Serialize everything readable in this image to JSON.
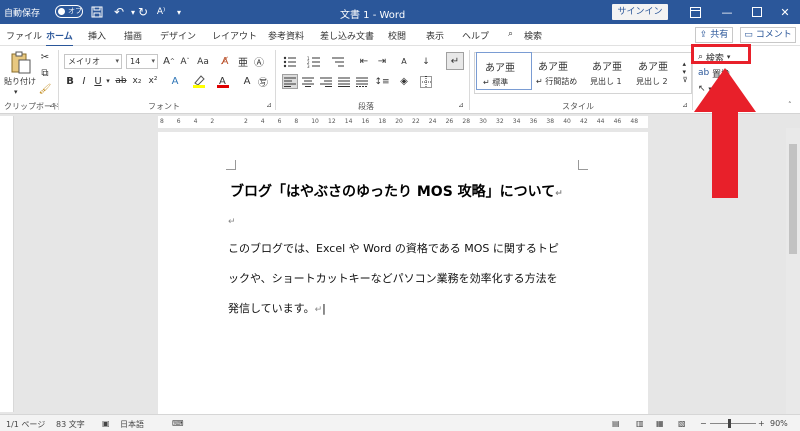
{
  "titlebar": {
    "autosave": "自動保存",
    "toggle": "オフ",
    "doc_title": "文書 1 - Word",
    "signin": "サインイン"
  },
  "tabs": [
    "ファイル",
    "ホーム",
    "挿入",
    "描画",
    "デザイン",
    "レイアウト",
    "参考資料",
    "差し込み文書",
    "校閲",
    "表示",
    "ヘルプ",
    "検索"
  ],
  "share": "共有",
  "comment": "コメント",
  "ribbon": {
    "paste": "貼り付け",
    "clipboard": "クリップボード",
    "font_name": "メイリオ",
    "font_size": "14",
    "font_group": "フォント",
    "paragraph_group": "段落",
    "styles_group": "スタイル",
    "styles": [
      {
        "preview": "あア亜",
        "name": "標準"
      },
      {
        "preview": "あア亜",
        "name": "行間詰め"
      },
      {
        "preview": "あア亜",
        "name": "見出し 1"
      },
      {
        "preview": "あア亜",
        "name": "見出し 2"
      }
    ],
    "search": "検索",
    "replace": "置換"
  },
  "ruler_ticks": [
    "8",
    "6",
    "4",
    "2",
    "",
    "2",
    "4",
    "6",
    "8",
    "10",
    "12",
    "14",
    "16",
    "18",
    "20",
    "22",
    "24",
    "26",
    "28",
    "30",
    "32",
    "34",
    "36",
    "38",
    "40",
    "42",
    "44",
    "46",
    "48"
  ],
  "document": {
    "title": "ブログ「はやぶさのゆったり MOS 攻略」について",
    "lines": [
      "このブログでは、Excel や Word の資格である MOS に関するトピ",
      "ックや、ショートカットキーなどパソコン業務を効率化する方法を",
      "発信しています。"
    ]
  },
  "status": {
    "page": "1/1 ページ",
    "words": "83 文字",
    "lang": "日本語",
    "zoom": "90%"
  },
  "colors": {
    "brand": "#2b579a",
    "highlight": "#e8202a"
  }
}
